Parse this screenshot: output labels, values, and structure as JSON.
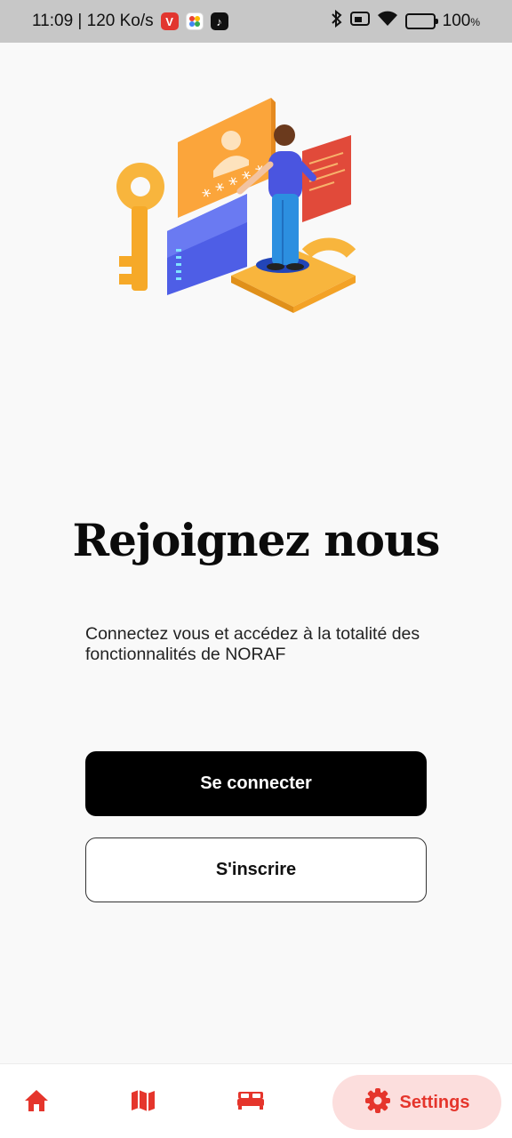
{
  "status_bar": {
    "time_speed": "11:09 | 120 Ko/s",
    "battery_percent": "100",
    "battery_unit": "%",
    "icons": [
      "vivaldi-icon",
      "google-photos-icon",
      "tiktok-icon",
      "bluetooth-icon",
      "sim-icon",
      "wifi-icon",
      "battery-icon"
    ]
  },
  "main": {
    "title": "Rejoignez nous",
    "subtitle": "Connectez vous et accédez à la totalité des fonctionnalités de NORAF",
    "login_button": "Se connecter",
    "signup_button": "S'inscrire"
  },
  "bottom_nav": {
    "items": [
      {
        "icon": "home-icon",
        "active": false
      },
      {
        "icon": "map-icon",
        "active": false
      },
      {
        "icon": "bed-icon",
        "active": false
      },
      {
        "icon": "gear-icon",
        "label": "Settings",
        "active": true
      }
    ]
  },
  "colors": {
    "accent": "#e5352c",
    "accent_soft": "#fcdedd",
    "primary_button": "#000000",
    "background": "#f9f9f9",
    "status_bar": "#c7c7c7"
  }
}
